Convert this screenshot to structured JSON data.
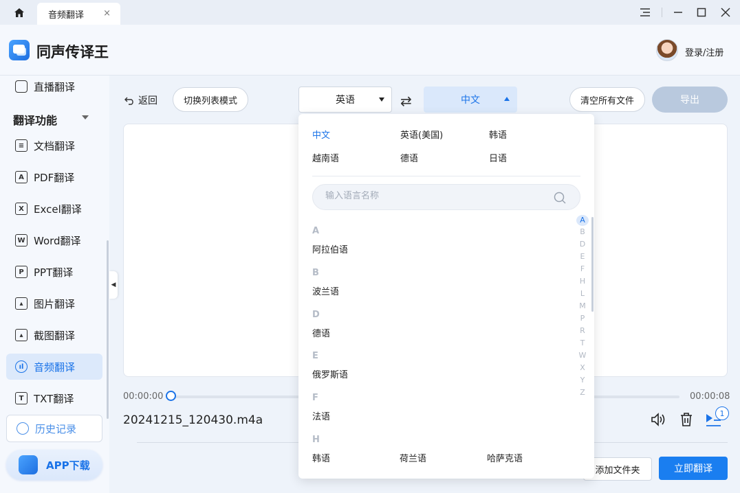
{
  "titlebar": {
    "tab_label": "音频翻译",
    "tab_close": "×",
    "home_icon": "home-icon",
    "window_buttons": [
      "menu-icon",
      "minimize-icon",
      "maximize-icon",
      "close-icon"
    ]
  },
  "header": {
    "app_title": "同声传译王",
    "login_label": "登录/注册"
  },
  "sidebar": {
    "top_item": "直播翻译",
    "section_title": "翻译功能",
    "items": [
      {
        "label": "文档翻译",
        "icon": "document-icon"
      },
      {
        "label": "PDF翻译",
        "icon": "pdf-icon"
      },
      {
        "label": "Excel翻译",
        "icon": "excel-icon"
      },
      {
        "label": "Word翻译",
        "icon": "word-icon"
      },
      {
        "label": "PPT翻译",
        "icon": "ppt-icon"
      },
      {
        "label": "图片翻译",
        "icon": "image-icon"
      },
      {
        "label": "截图翻译",
        "icon": "screenshot-icon"
      },
      {
        "label": "音频翻译",
        "icon": "audio-icon",
        "active": true
      },
      {
        "label": "TXT翻译",
        "icon": "txt-icon"
      }
    ],
    "history_label": "历史记录",
    "app_download_label": "APP下载"
  },
  "toolbar": {
    "back_label": "返回",
    "list_mode_label": "切换列表模式",
    "source_lang": "英语",
    "target_lang": "中文",
    "clear_label": "清空所有文件",
    "export_label": "导出"
  },
  "player": {
    "time_start": "00:00:00",
    "time_end": "00:00:08",
    "progress": 0.0,
    "filename": "20241215_120430.m4a",
    "queue_count": "1"
  },
  "footer": {
    "add_folder_label": "添加文件夹",
    "translate_label": "立即翻译"
  },
  "dropdown": {
    "quick_langs": [
      "中文",
      "英语(美国)",
      "韩语",
      "越南语",
      "德语",
      "日语"
    ],
    "selected": "中文",
    "search_placeholder": "输入语言名称",
    "groups": [
      {
        "letter": "A",
        "langs": [
          "阿拉伯语"
        ]
      },
      {
        "letter": "B",
        "langs": [
          "波兰语"
        ]
      },
      {
        "letter": "D",
        "langs": [
          "德语"
        ]
      },
      {
        "letter": "E",
        "langs": [
          "俄罗斯语"
        ]
      },
      {
        "letter": "F",
        "langs": [
          "法语"
        ]
      },
      {
        "letter": "H",
        "langs": [
          "韩语",
          "荷兰语",
          "哈萨克语"
        ]
      }
    ],
    "index_letters": [
      "A",
      "B",
      "D",
      "E",
      "F",
      "H",
      "L",
      "M",
      "P",
      "R",
      "T",
      "W",
      "X",
      "Y",
      "Z"
    ],
    "index_selected": "A"
  },
  "colors": {
    "accent": "#1a73e8",
    "primary_button": "#1a7ef0",
    "export_disabled": "#b9c9de"
  }
}
